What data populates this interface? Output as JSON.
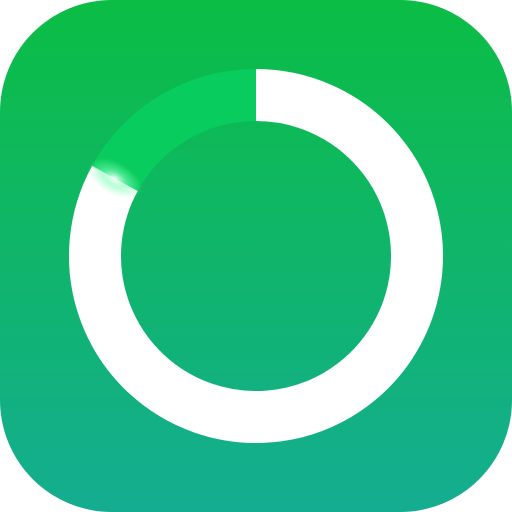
{
  "app_icon": {
    "icon": "progress-ring-icon",
    "colors": {
      "gradient_top": "#0bbd44",
      "gradient_bottom": "#14ad91",
      "ring": "#ffffff",
      "track_highlight": "#09cc5e",
      "glow": "#7dffb8"
    },
    "progress_fraction": 0.83
  }
}
